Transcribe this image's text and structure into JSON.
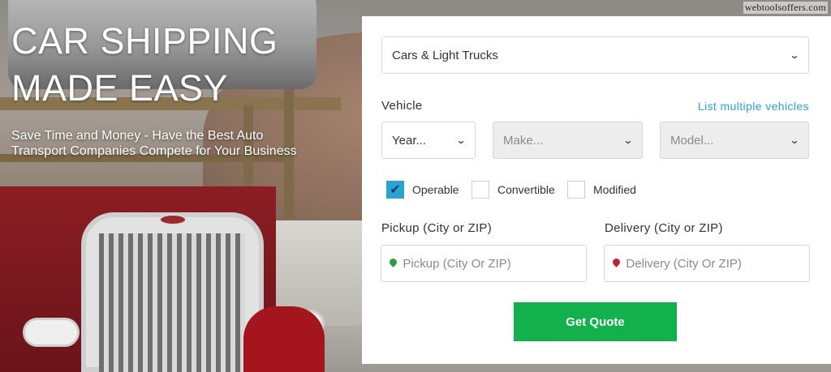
{
  "watermark": "webtoolsoffers.com",
  "hero": {
    "headline_line1": "CAR SHIPPING",
    "headline_line2": "MADE EASY",
    "subheadline": "Save Time and Money - Have the Best Auto Transport Companies Compete for Your Business"
  },
  "form": {
    "vehicle_type": {
      "selected": "Cars & Light Trucks"
    },
    "vehicle_label": "Vehicle",
    "multiple_link": "List multiple vehicles",
    "year": {
      "selected": "Year..."
    },
    "make": {
      "selected": "Make..."
    },
    "model": {
      "selected": "Model..."
    },
    "options": [
      {
        "label": "Operable",
        "checked": true
      },
      {
        "label": "Convertible",
        "checked": false
      },
      {
        "label": "Modified",
        "checked": false
      }
    ],
    "pickup": {
      "label": "Pickup (City or ZIP)",
      "placeholder": "Pickup (City Or ZIP)"
    },
    "delivery": {
      "label": "Delivery (City or ZIP)",
      "placeholder": "Delivery (City Or ZIP)"
    },
    "submit_label": "Get Quote"
  },
  "colors": {
    "accent": "#2aa3d3",
    "cta": "#12b14b",
    "pickup_pin": "#2e9e3a",
    "delivery_pin": "#c0232b"
  },
  "icons": {
    "dropdown": "chevron-down-icon",
    "checkbox_checked": "checkmark-icon",
    "pickup": "map-pin-icon",
    "delivery": "map-pin-icon"
  }
}
